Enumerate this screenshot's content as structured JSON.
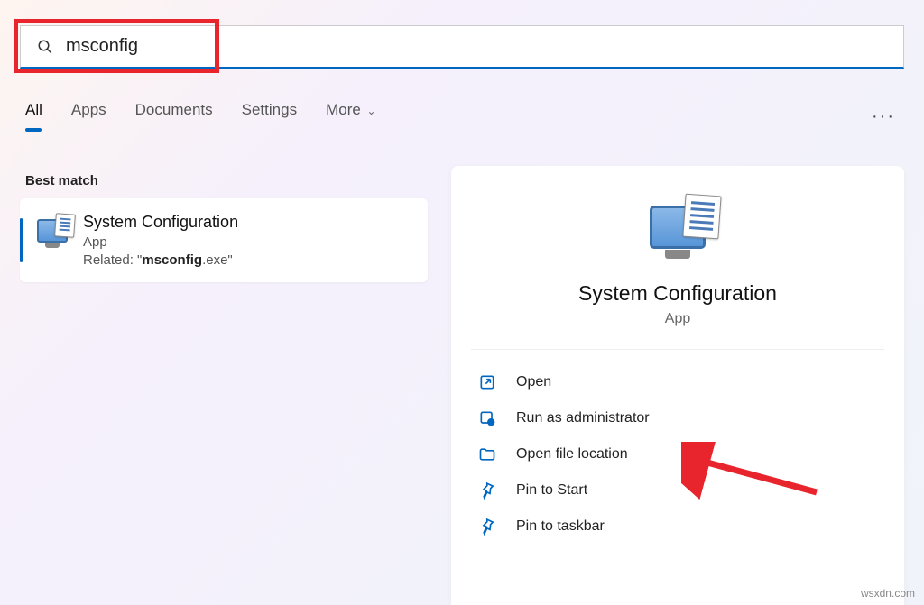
{
  "search": {
    "value": "msconfig"
  },
  "tabs": {
    "all": "All",
    "apps": "Apps",
    "documents": "Documents",
    "settings": "Settings",
    "more": "More"
  },
  "best_match_label": "Best match",
  "result": {
    "title": "System Configuration",
    "type": "App",
    "related_prefix": "Related: \"",
    "related_bold": "msconfig",
    "related_suffix": ".exe\""
  },
  "detail": {
    "title": "System Configuration",
    "type": "App"
  },
  "actions": {
    "open": "Open",
    "admin": "Run as administrator",
    "location": "Open file location",
    "pin_start": "Pin to Start",
    "pin_taskbar": "Pin to taskbar"
  },
  "watermark": "wsxdn.com"
}
